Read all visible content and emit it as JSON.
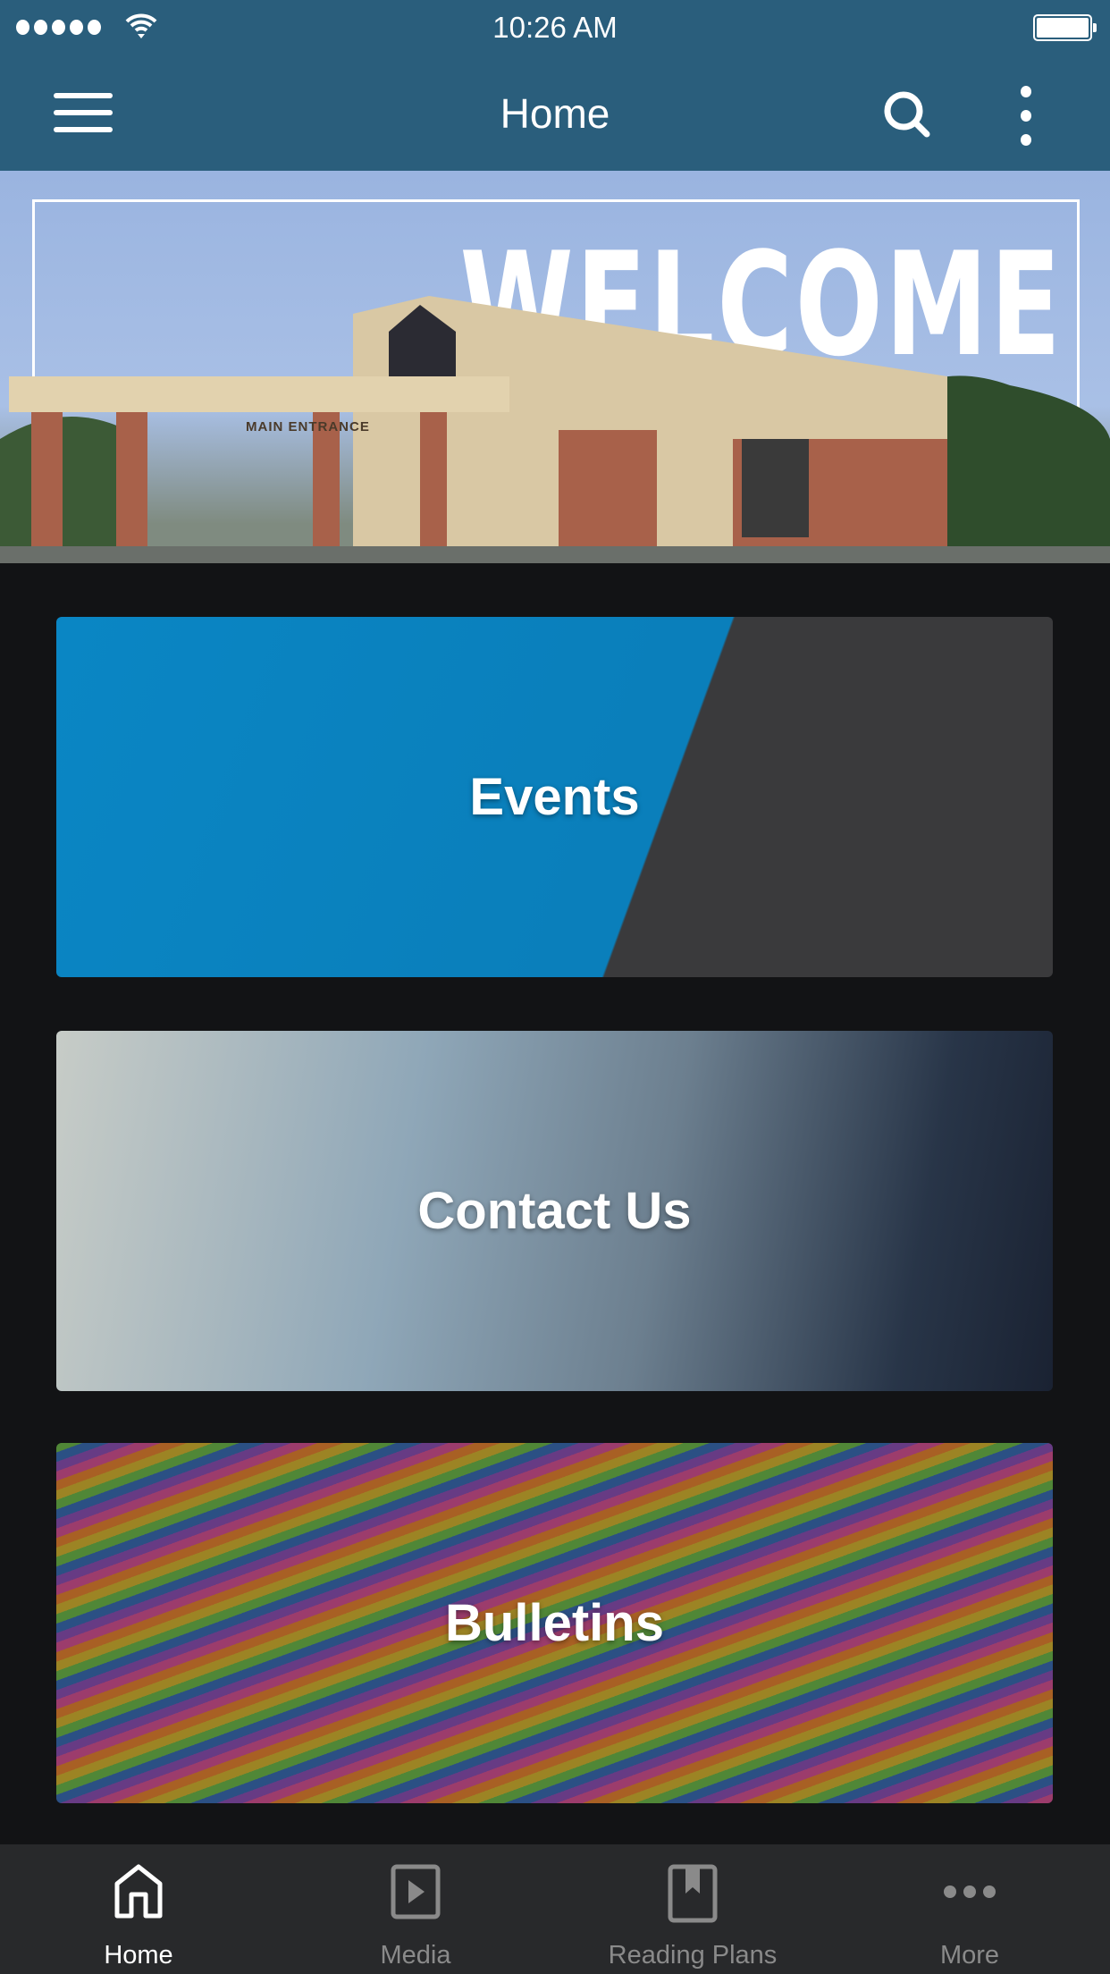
{
  "status_bar": {
    "time": "10:26 AM"
  },
  "header": {
    "title": "Home"
  },
  "banner": {
    "headline": "WELCOME",
    "sign": "MAIN ENTRANCE"
  },
  "cards": [
    {
      "label": "Events"
    },
    {
      "label": "Contact Us"
    },
    {
      "label": "Bulletins"
    }
  ],
  "tabs": [
    {
      "label": "Home",
      "icon": "home-icon",
      "active": true
    },
    {
      "label": "Media",
      "icon": "play-icon"
    },
    {
      "label": "Reading Plans",
      "icon": "bookmark-book-icon"
    },
    {
      "label": "More",
      "icon": "more-dots-icon"
    }
  ],
  "colors": {
    "header": "#2a5e7c",
    "background": "#121315",
    "tabbar": "#28292b",
    "active": "#ffffff",
    "inactive": "#8a8a8a"
  }
}
